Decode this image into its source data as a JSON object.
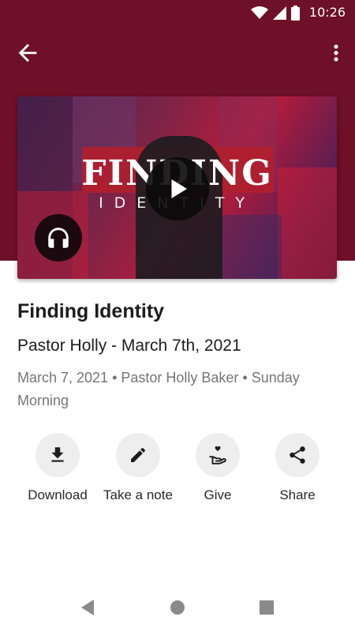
{
  "status_bar": {
    "time": "10:26"
  },
  "media": {
    "art_title": "FINDING",
    "art_subtitle": "IDENTITY",
    "play_icon": "play-icon",
    "audio_icon": "headphones-icon"
  },
  "sermon": {
    "title": "Finding Identity",
    "subtitle": "Pastor Holly - March 7th, 2021",
    "meta": "March 7, 2021 • Pastor Holly Baker • Sunday Morning"
  },
  "actions": [
    {
      "label": "Download",
      "icon": "download-icon"
    },
    {
      "label": "Take a note",
      "icon": "pencil-icon"
    },
    {
      "label": "Give",
      "icon": "give-icon"
    },
    {
      "label": "Share",
      "icon": "share-icon"
    }
  ],
  "colors": {
    "header_bg": "#6e1027",
    "text_primary": "#1d1d1d",
    "text_secondary": "#757575",
    "action_circle": "#eeeeee"
  }
}
